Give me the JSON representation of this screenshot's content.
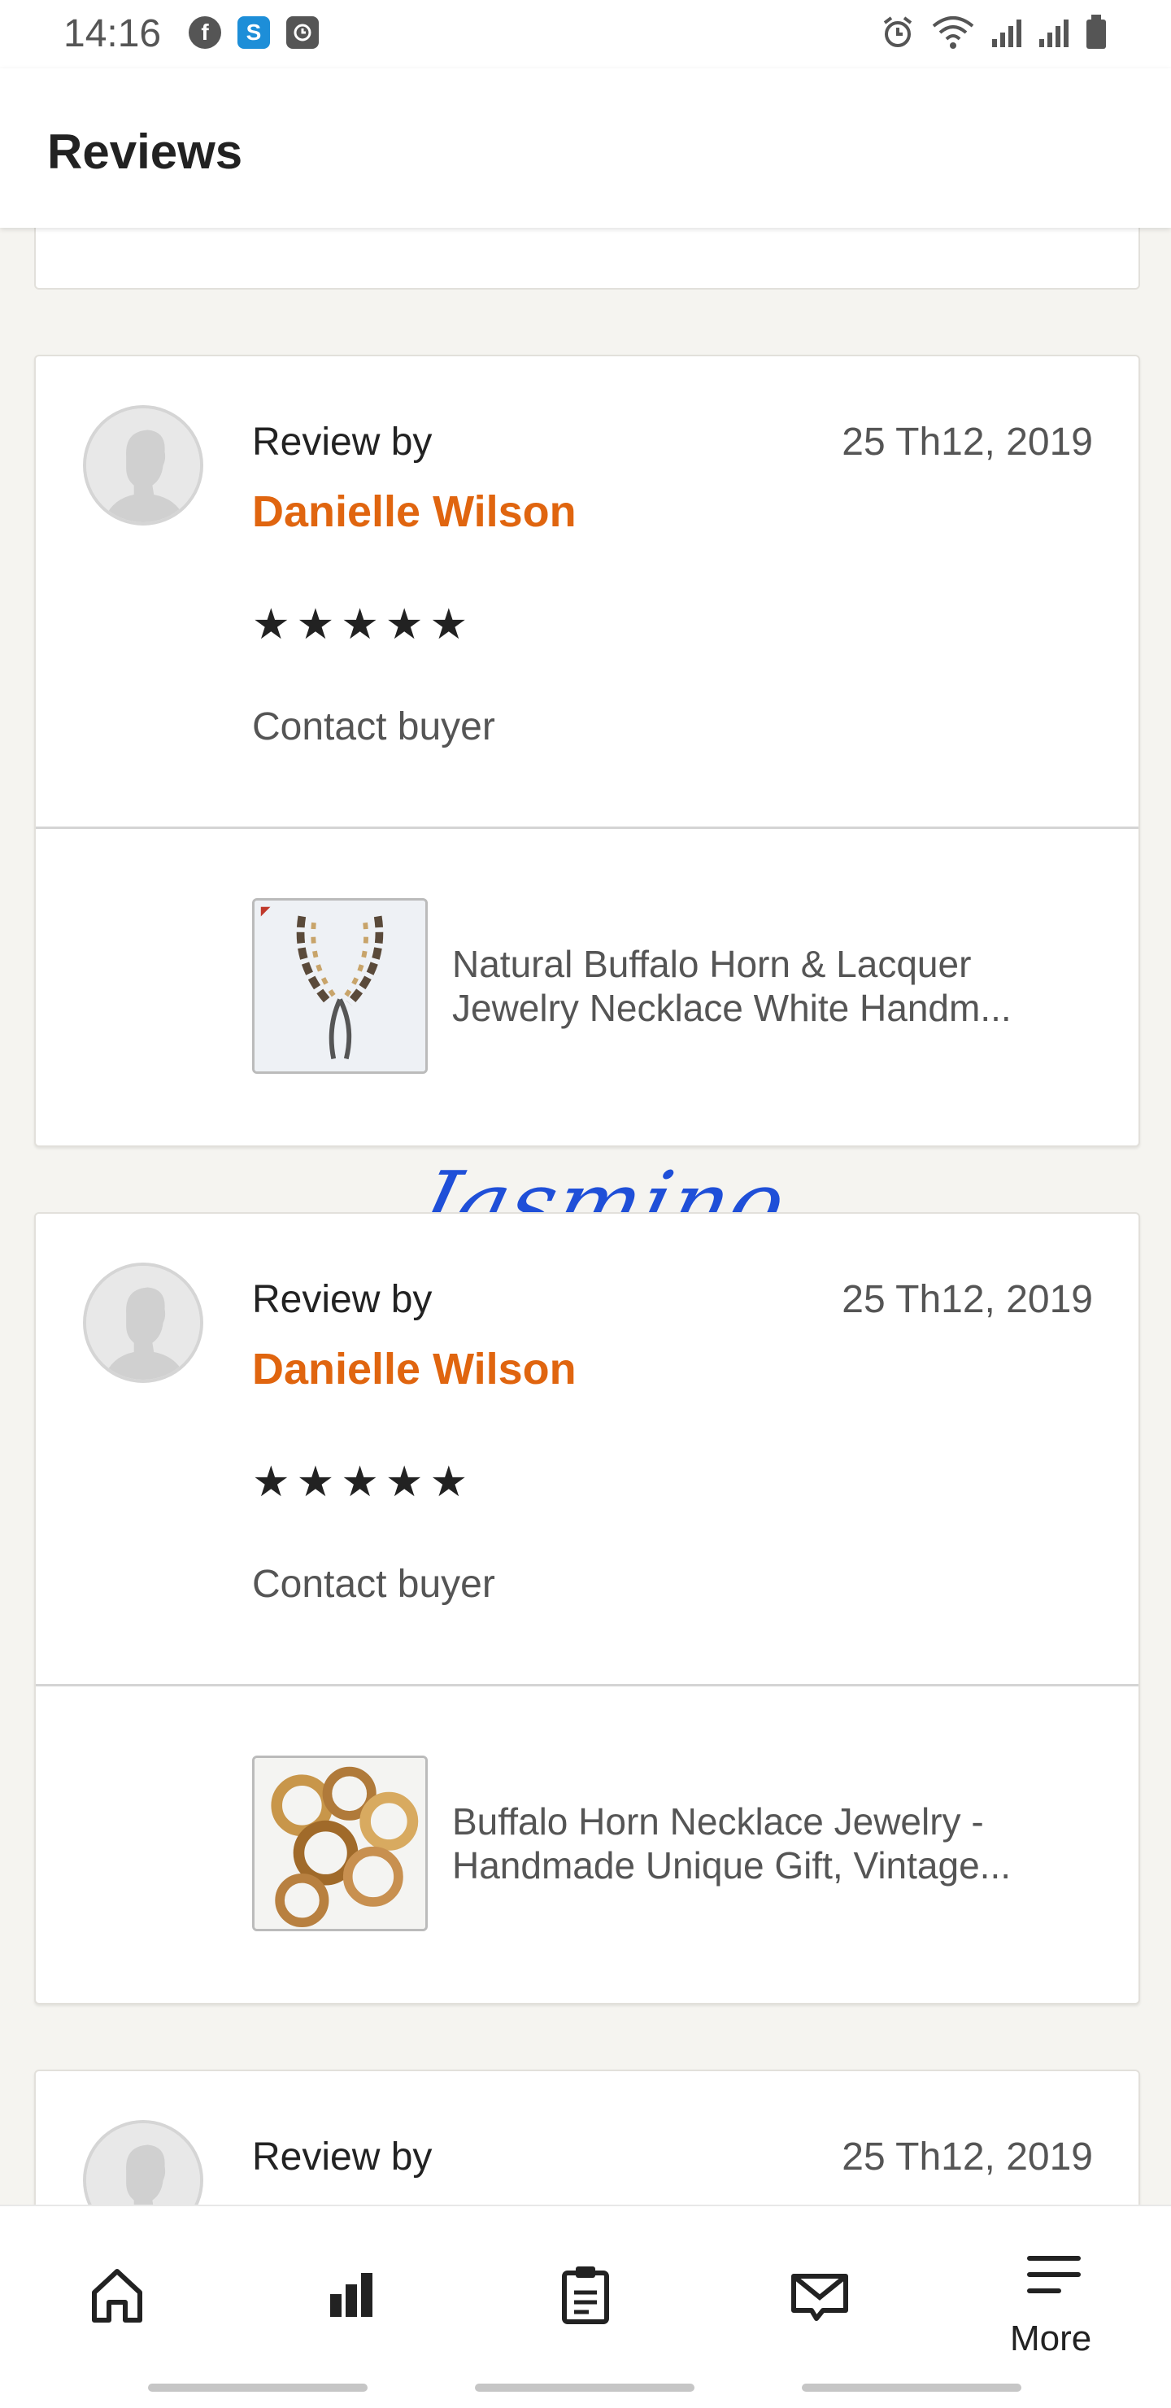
{
  "status_bar": {
    "time": "14:16",
    "app_icons": [
      "facebook-icon",
      "skype-icon",
      "clock-app-icon"
    ],
    "system_icons": [
      "alarm-icon",
      "wifi-icon",
      "signal-icon",
      "signal-icon",
      "battery-icon"
    ]
  },
  "header": {
    "title": "Reviews"
  },
  "reviews": [
    {
      "review_by_label": "Review by",
      "reviewer": "Danielle Wilson",
      "date": "25 Th12, 2019",
      "stars": "★★★★★",
      "rating": 5,
      "contact_label": "Contact buyer",
      "listing_title": "Natural Buffalo Horn & Lacquer Jewelry Necklace White Handm..."
    },
    {
      "review_by_label": "Review by",
      "reviewer": "Danielle Wilson",
      "date": "25 Th12, 2019",
      "stars": "★★★★★",
      "rating": 5,
      "contact_label": "Contact buyer",
      "listing_title": "Buffalo Horn Necklace Jewelry - Handmade Unique Gift, Vintage..."
    },
    {
      "review_by_label": "Review by",
      "date": "25 Th12, 2019"
    }
  ],
  "watermark": "Jasmino",
  "bottom_nav": {
    "items": [
      "home-icon",
      "stats-icon",
      "orders-icon",
      "messages-icon",
      "menu-icon"
    ],
    "more_label": "More"
  },
  "colors": {
    "accent": "#e0650f",
    "watermark": "#1f4fd8"
  }
}
